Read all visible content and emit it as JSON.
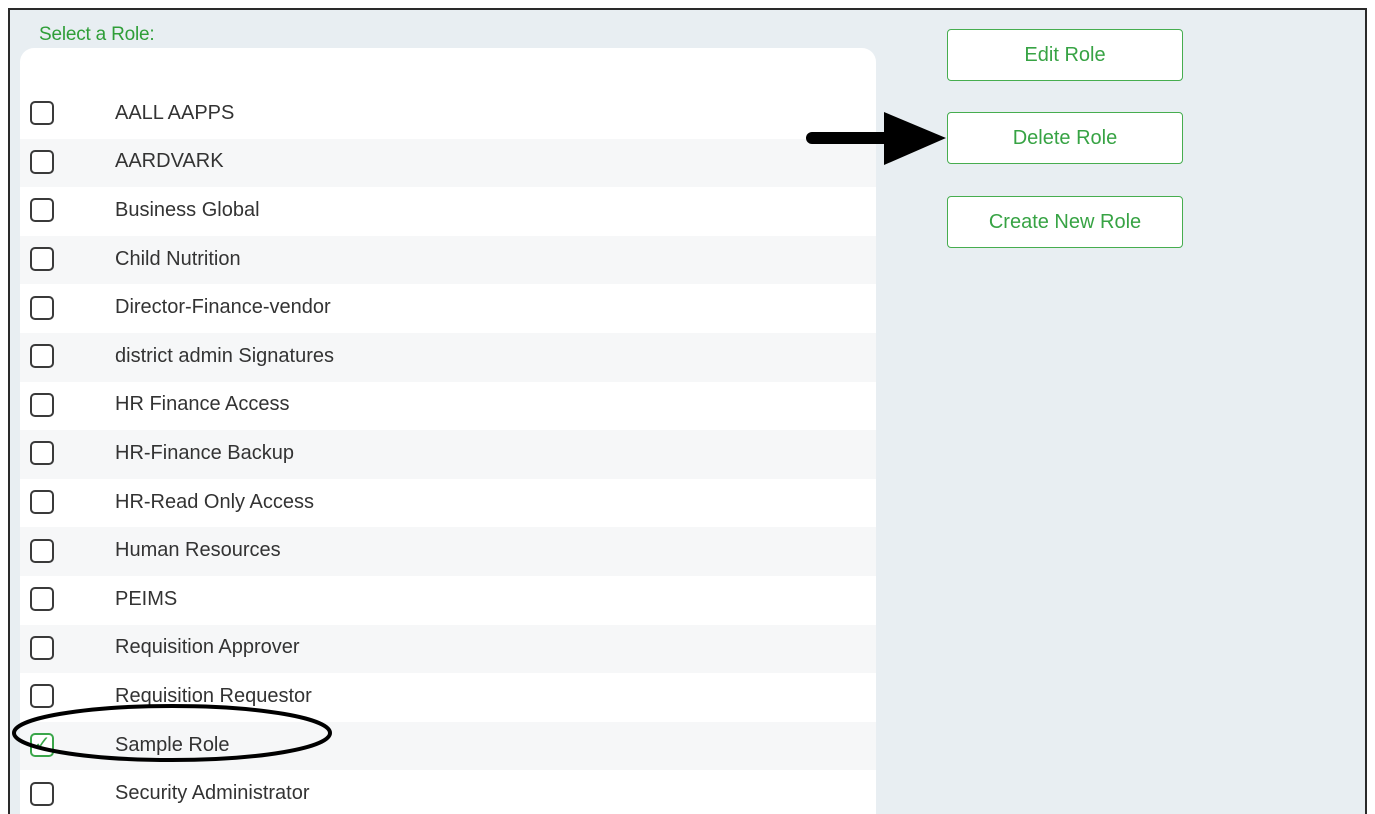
{
  "role_selector": {
    "title": "Select a Role:",
    "roles": [
      {
        "label": "AALL AAPPS",
        "checked": false
      },
      {
        "label": "AARDVARK",
        "checked": false
      },
      {
        "label": "Business Global",
        "checked": false
      },
      {
        "label": "Child Nutrition",
        "checked": false
      },
      {
        "label": "Director-Finance-vendor",
        "checked": false
      },
      {
        "label": "district admin Signatures",
        "checked": false
      },
      {
        "label": "HR Finance Access",
        "checked": false
      },
      {
        "label": "HR-Finance Backup",
        "checked": false
      },
      {
        "label": "HR-Read Only Access",
        "checked": false
      },
      {
        "label": "Human Resources",
        "checked": false
      },
      {
        "label": "PEIMS",
        "checked": false
      },
      {
        "label": "Requisition Approver",
        "checked": false
      },
      {
        "label": "Requisition Requestor",
        "checked": false
      },
      {
        "label": "Sample Role",
        "checked": true
      },
      {
        "label": "Security Administrator",
        "checked": false
      }
    ]
  },
  "actions": {
    "edit_role_label": "Edit Role",
    "delete_role_label": "Delete Role",
    "create_new_role_label": "Create New Role"
  },
  "icons": {
    "checkmark": "check-icon",
    "annotation_arrow": "arrow-right-icon",
    "annotation_circle": "ellipse-highlight"
  },
  "colors": {
    "accent_green": "#37a344",
    "panel_background": "#e8eef2",
    "row_alt_background": "#f6f7f8",
    "text": "#333333",
    "annotation": "#000000"
  }
}
